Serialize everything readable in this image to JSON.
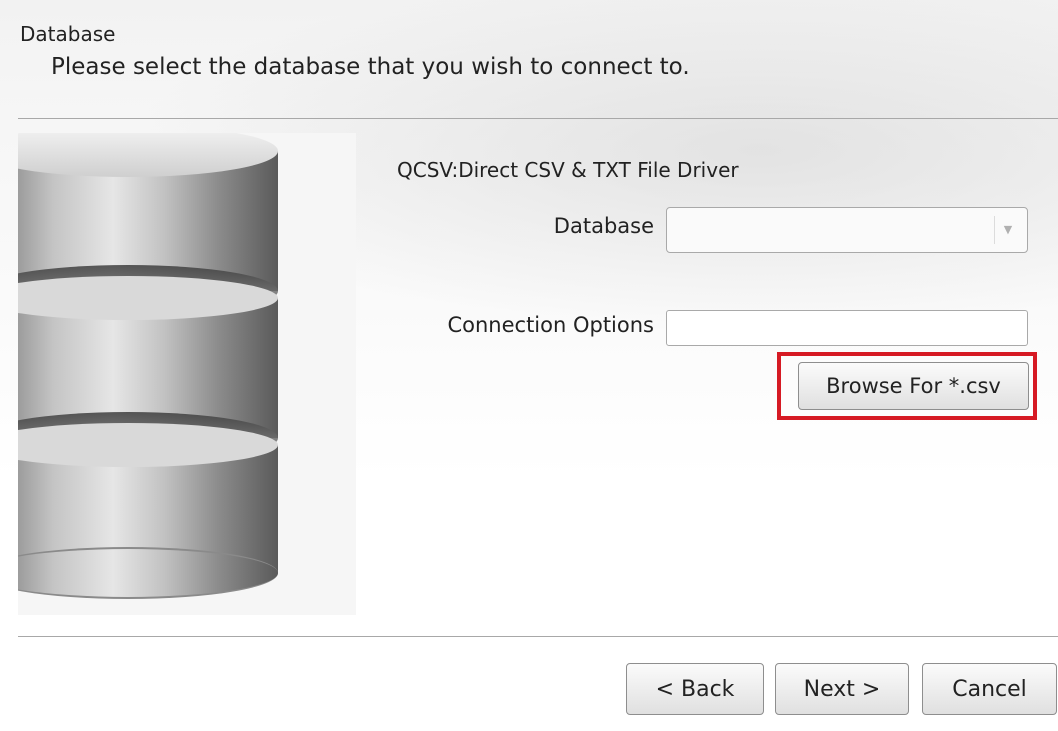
{
  "header": {
    "title": "Database",
    "subtitle": "Please select the database that you wish to connect to."
  },
  "main": {
    "driver_label": "QCSV:Direct CSV & TXT File Driver",
    "database_label": "Database",
    "database_value": "",
    "connection_options_label": "Connection Options",
    "connection_options_value": "",
    "browse_button_label": "Browse For *.csv"
  },
  "footer": {
    "back_label": "< Back",
    "next_label": "Next >",
    "cancel_label": "Cancel"
  },
  "icons": {
    "database_image": "database-cylinder-icon",
    "dropdown_arrow": "chevron-down-icon"
  },
  "colors": {
    "highlight": "#d61a24",
    "divider": "#a8a8a8"
  }
}
